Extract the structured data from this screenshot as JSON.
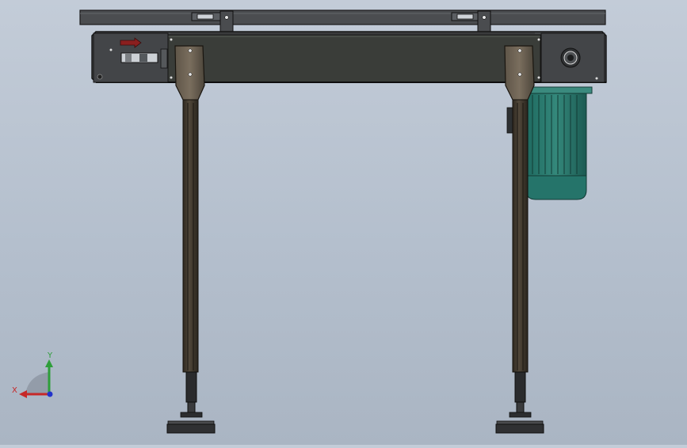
{
  "viewport": {
    "model": "chain-conveyor-assembly",
    "view": "front"
  },
  "colors": {
    "frame": "#4a4b4c",
    "frame_edge": "#1c1c1c",
    "belt_panel": "#3a3c38",
    "leg": "#4b4336",
    "leg_dark": "#2f2a22",
    "motor": "#2f7e72",
    "motor_dark": "#1e5d55",
    "arrow": "#8a1f1f",
    "axis_x": "#c62828",
    "axis_y": "#2e9e3a",
    "axis_z": "#2233cc"
  },
  "triad": {
    "x_label": "X",
    "y_label": "Y"
  }
}
